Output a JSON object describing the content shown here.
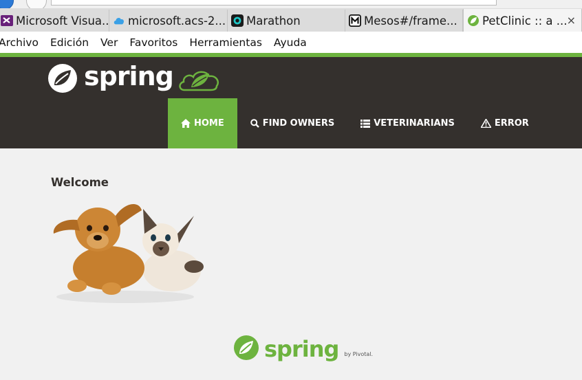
{
  "browser": {
    "tabs": [
      {
        "label": "Microsoft Visua...",
        "icon": "visual-studio-icon",
        "active": false
      },
      {
        "label": "microsoft.acs-2...",
        "icon": "azure-cloud-icon",
        "active": false
      },
      {
        "label": "Marathon",
        "icon": "marathon-icon",
        "active": false
      },
      {
        "label": "Mesos#/frame...",
        "icon": "mesos-icon",
        "active": false
      },
      {
        "label": "PetClinic :: a ...",
        "icon": "spring-leaf-icon",
        "active": true
      }
    ],
    "close_glyph": "×",
    "menu": [
      "Archivo",
      "Edición",
      "Ver",
      "Favoritos",
      "Herramientas",
      "Ayuda"
    ]
  },
  "site": {
    "brand": "spring",
    "nav": [
      {
        "label": "HOME",
        "icon": "home-icon",
        "active": true
      },
      {
        "label": "FIND OWNERS",
        "icon": "search-icon",
        "active": false
      },
      {
        "label": "VETERINARIANS",
        "icon": "list-icon",
        "active": false
      },
      {
        "label": "ERROR",
        "icon": "warning-icon",
        "active": false
      }
    ],
    "welcome": "Welcome",
    "footer_brand": "spring",
    "footer_by": "by Pivotal."
  },
  "colors": {
    "accent_green": "#6db33f",
    "header_dark": "#34302d",
    "page_bg": "#f1f1f1"
  }
}
